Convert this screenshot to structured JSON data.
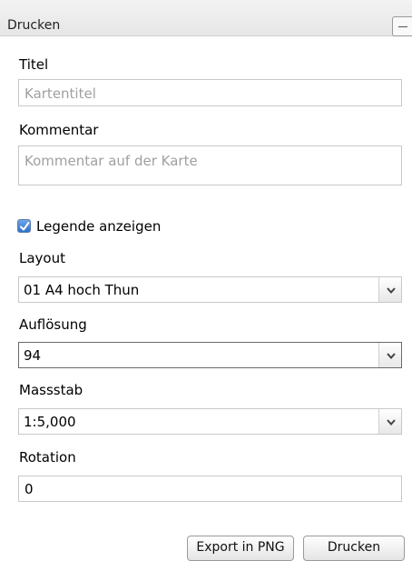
{
  "panel": {
    "title": "Drucken"
  },
  "title_field": {
    "label": "Titel",
    "placeholder": "Kartentitel",
    "value": ""
  },
  "comment_field": {
    "label": "Kommentar",
    "placeholder": "Kommentar auf der Karte",
    "value": ""
  },
  "legend": {
    "label": "Legende anzeigen",
    "checked": true
  },
  "layout": {
    "label": "Layout",
    "selected": "01 A4 hoch Thun"
  },
  "resolution": {
    "label": "Auflösung",
    "selected": "94"
  },
  "scale": {
    "label": "Massstab",
    "selected": "1:5,000"
  },
  "rotation": {
    "label": "Rotation",
    "value": "0"
  },
  "buttons": {
    "export": "Export in PNG",
    "print": "Drucken"
  },
  "icons": {
    "collapse": "minus-icon",
    "dropdown": "chevron-down-icon",
    "check": "checkmark-icon"
  },
  "colors": {
    "checkbox": "#2f72c8",
    "placeholder": "#a0a0a0"
  }
}
